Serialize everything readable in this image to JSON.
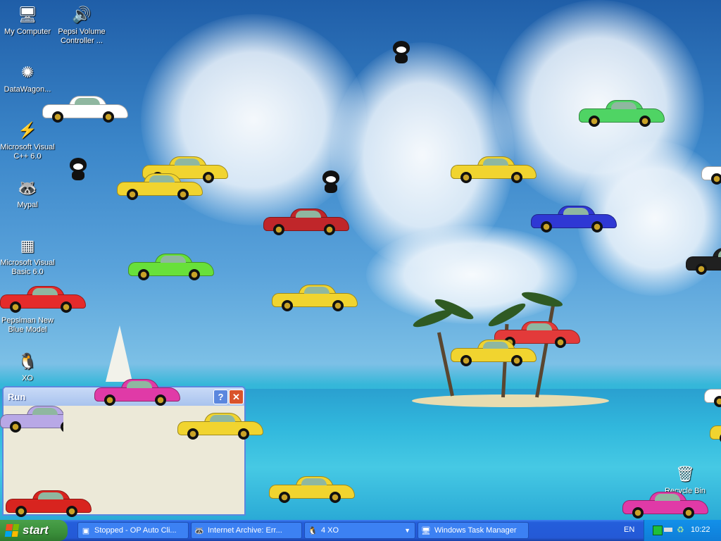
{
  "desktop": {
    "icons": [
      {
        "label": "My Computer",
        "icon": "computer-icon"
      },
      {
        "label": "Pepsi Volume Controller ...",
        "icon": "pepsi-volume-icon"
      },
      {
        "label": "DataWagon...",
        "icon": "datawagon-icon"
      },
      {
        "label": "Microsoft Visual C++ 6.0",
        "icon": "visual-cpp-icon"
      },
      {
        "label": "Mypal",
        "icon": "mypal-icon"
      },
      {
        "label": "Microsoft Visual Basic 6.0",
        "icon": "visual-basic-icon"
      },
      {
        "label": "Pepsiman New Blue Model",
        "icon": "pepsiman-icon"
      },
      {
        "label": "XO",
        "icon": "xo-penguin-icon"
      },
      {
        "label": "Recycle Bin",
        "icon": "recycle-bin-icon"
      }
    ],
    "car_colors": [
      "#ffffff",
      "#4fd464",
      "#f1d42f",
      "#f1d42f",
      "#ffffff",
      "#f1d42f",
      "#c0262a",
      "#2f38d4",
      "#68e03a",
      "#202020",
      "#e52b2b",
      "#f1d42f",
      "#e33a3a",
      "#f1d42f",
      "#e03aa7",
      "#ffffff",
      "#b8a8e6",
      "#f1d42f",
      "#f1d42f",
      "#d8241f",
      "#f1d42f",
      "#e03aa7"
    ]
  },
  "run_dialog": {
    "title": "Run",
    "help_label": "?",
    "close_label": "✕"
  },
  "taskbar": {
    "start_label": "start",
    "tasks": [
      {
        "label": "Stopped - OP Auto Cli...",
        "icon": "op-autoclicker-icon"
      },
      {
        "label": "Internet Archive: Err...",
        "icon": "mypal-browser-icon"
      },
      {
        "label": "4 XO",
        "icon": "xo-penguin-icon"
      },
      {
        "label": "Windows Task Manager",
        "icon": "task-manager-icon"
      }
    ],
    "language": "EN",
    "clock": "10:22"
  }
}
